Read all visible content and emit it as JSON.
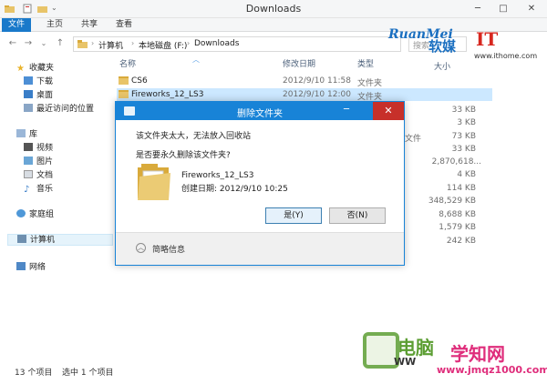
{
  "window": {
    "title": "Downloads",
    "minimize": "─",
    "maximize": "□",
    "close": "✕"
  },
  "ribbon": {
    "tabs": [
      "文件",
      "主页",
      "共享",
      "查看"
    ]
  },
  "nav": {
    "back": "←",
    "forward": "→",
    "dropdown": "⌄",
    "up": "↑",
    "breadcrumbs": [
      "计算机",
      "本地磁盘 (F:)",
      "Downloads"
    ],
    "search_placeholder": "搜索"
  },
  "watermark": {
    "ruanmei": "RuanMei",
    "ruanmei_cn": "软媒",
    "ithome": "IT",
    "ithome_url": "www.ithome.com",
    "bottom_left": "电脑",
    "bottom_left_sub": "WW",
    "bottom_right": "学知网",
    "bottom_right_url": "www.jmqz1000.com"
  },
  "sidebar": {
    "favorites": {
      "label": "收藏夹",
      "items": [
        "下载",
        "桌面",
        "最近访问的位置"
      ]
    },
    "libraries": {
      "label": "库",
      "items": [
        "视频",
        "图片",
        "文档",
        "音乐"
      ]
    },
    "homegroup": "家庭组",
    "computer": "计算机",
    "network": "网络"
  },
  "file_list": {
    "columns": {
      "name": "名称",
      "date": "修改日期",
      "type": "类型",
      "size": "大小"
    },
    "rows": [
      {
        "name": "CS6",
        "date": "2012/9/10 11:58",
        "type": "文件夹",
        "size": ""
      },
      {
        "name": "Fireworks_12_LS3",
        "date": "2012/9/10 12:00",
        "type": "文件夹",
        "size": ""
      }
    ],
    "hidden_type": "文件",
    "sizes": [
      "33 KB",
      "3 KB",
      "73 KB",
      "33 KB",
      "2,870,618...",
      "4 KB",
      "114 KB",
      "348,529 KB",
      "8,688 KB",
      "1,579 KB",
      "242 KB"
    ]
  },
  "status": {
    "count": "13 个项目",
    "selected": "选中 1 个项目"
  },
  "dialog": {
    "title": "删除文件夹",
    "message": "该文件夹太大，无法放入回收站",
    "question": "是否要永久删除该文件夹?",
    "folder_name": "Fireworks_12_LS3",
    "created": "创建日期: 2012/9/10 10:25",
    "yes": "是(Y)",
    "no": "否(N)",
    "details": "简略信息",
    "minimize": "─",
    "close": "✕",
    "chevron": "︿"
  },
  "colors": {
    "accent": "#1883d7",
    "file_tab": "#1979ca",
    "close_red": "#c7302a",
    "folder": "#e8c469"
  }
}
